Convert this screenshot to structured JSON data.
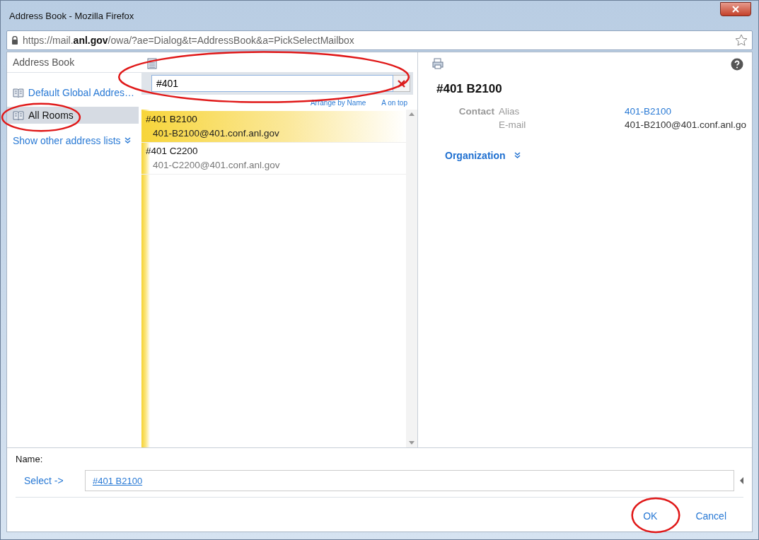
{
  "window": {
    "title": "Address Book - Mozilla Firefox"
  },
  "address_bar": {
    "url": "https://mail.**anl.gov**/owa/?ae=Dialog&t=AddressBook&a=PickSelectMailbox"
  },
  "sidebar": {
    "heading": "Address Book",
    "items": [
      {
        "label": "Default Global Addres…",
        "selected": false,
        "circled": false
      },
      {
        "label": "All Rooms",
        "selected": true,
        "circled": true
      }
    ],
    "more_link": "Show other address lists"
  },
  "search": {
    "value": "#401",
    "circled": true
  },
  "sort": {
    "arrange": "Arrange by Name",
    "order": "A on top"
  },
  "results": [
    {
      "name": "#401 B2100",
      "email": "401-B2100@401.conf.anl.gov",
      "selected": true
    },
    {
      "name": "#401 C2200",
      "email": "401-C2200@401.conf.anl.gov",
      "selected": false
    }
  ],
  "details": {
    "title": "#401 B2100",
    "section": "Contact",
    "fields": [
      {
        "label": "Alias",
        "value": "401-B2100",
        "kind": "link"
      },
      {
        "label": "E-mail",
        "value": "401-B2100@401.conf.anl.go",
        "kind": "text"
      }
    ],
    "organization": "Organization"
  },
  "footer": {
    "name_label": "Name:",
    "select_link": "Select ->",
    "value": "#401 B2100",
    "buttons": [
      {
        "label": "OK",
        "circled": true
      },
      {
        "label": "Cancel",
        "circled": false
      }
    ]
  }
}
